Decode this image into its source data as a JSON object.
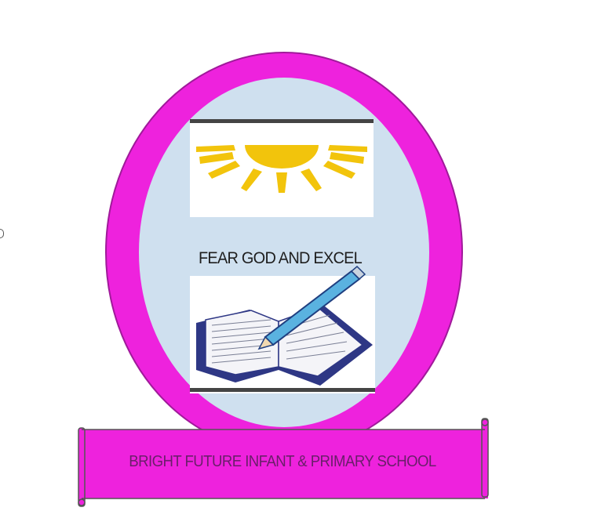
{
  "logo": {
    "motto": "FEAR GOD AND EXCEL",
    "school_name": "BRIGHT FUTURE INFANT & PRIMARY SCHOOL"
  },
  "icons": [
    "sun-icon",
    "open-book-icon",
    "pencil-icon"
  ],
  "colors": {
    "frame": "#ee22dd",
    "frame_outline": "#a01a9a",
    "inner_background": "#cfe0ef",
    "sun": "#f2c40c",
    "book_cover": "#2e3785",
    "pencil": "#5ab2e0",
    "banner": "#ee22dd",
    "text": "#1e1e1e"
  }
}
